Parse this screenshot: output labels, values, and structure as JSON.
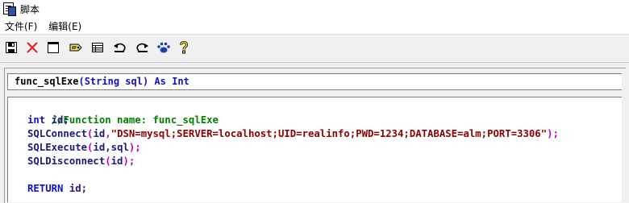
{
  "window": {
    "title": "脚本"
  },
  "menu": {
    "file": "文件(F)",
    "edit": "编辑(E)"
  },
  "toolbar": {
    "buttons": [
      "save-icon",
      "delete-icon",
      "new-window-icon",
      "tag-icon",
      "table-icon",
      "undo-icon",
      "redo-icon",
      "paw-icon",
      "help-icon"
    ]
  },
  "signature": {
    "name": "func_sqlExe",
    "params": "(String sql)",
    "as_kw": "As",
    "type": "Int"
  },
  "code": {
    "comment": "//Function name: func_sqlExe",
    "decl_kw": "int",
    "decl_rest": " id;",
    "connect_fn": "SQLConnect",
    "connect_open": "(",
    "connect_arg": "id",
    "connect_comma": ",",
    "connect_str": "\"DSN=mysql;SERVER=localhost;UID=realinfo;PWD=1234;DATABASE=alm;PORT=3306\"",
    "connect_close": ");",
    "execute_fn": "SQLExecute",
    "execute_open": "(",
    "execute_args": "id,sql",
    "execute_close": ");",
    "disconnect_fn": "SQLDisconnect",
    "disconnect_open": "(",
    "disconnect_arg": "id",
    "disconnect_close": ");",
    "return_kw": "RETURN",
    "return_rest": " id;"
  }
}
